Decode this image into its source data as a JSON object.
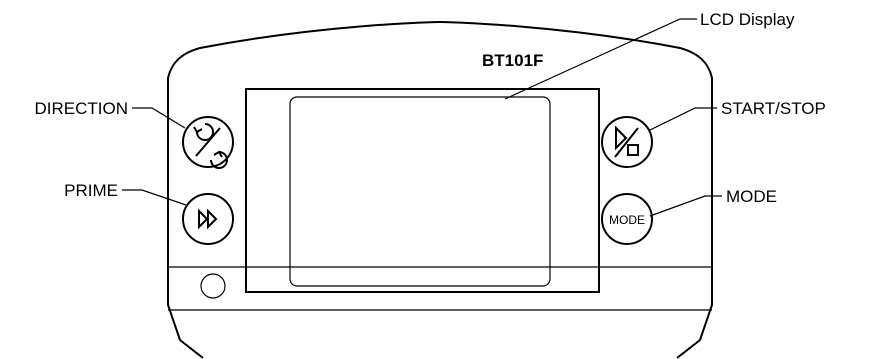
{
  "device": {
    "model": "BT101F"
  },
  "labels": {
    "lcd_display": "LCD Display",
    "direction": "DIRECTION",
    "prime": "PRIME",
    "start_stop": "START/STOP",
    "mode": "MODE"
  },
  "buttons": {
    "direction_icon": "direction-arrows-icon",
    "prime_icon": "fast-forward-icon",
    "start_stop_icon": "play-stop-icon",
    "mode_text": "MODE"
  }
}
